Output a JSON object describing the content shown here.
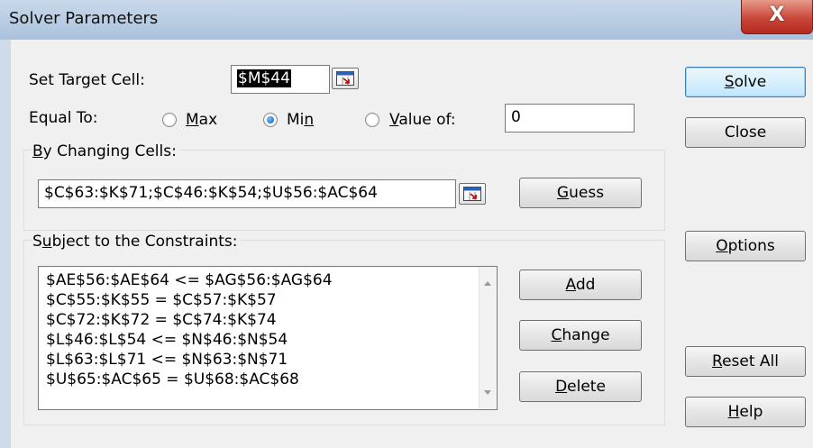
{
  "window": {
    "title": "Solver Parameters",
    "close_glyph": "X"
  },
  "target": {
    "label": "Set Target Cell:",
    "value": "$M$44"
  },
  "equal_to": {
    "label": "Equal To:",
    "options": [
      {
        "label": "Max",
        "selected": false
      },
      {
        "label": "Min",
        "selected": true
      },
      {
        "label": "Value of:",
        "selected": false
      }
    ],
    "value_of": "0"
  },
  "changing": {
    "label": "By Changing Cells:",
    "value": "$C$63:$K$71;$C$46:$K$54;$U$56:$AC$64",
    "guess_label": "Guess"
  },
  "constraints": {
    "label": "Subject to the Constraints:",
    "items": [
      "$AE$56:$AE$64 <= $AG$56:$AG$64",
      "$C$55:$K$55 = $C$57:$K$57",
      "$C$72:$K$72 = $C$74:$K$74",
      "$L$46:$L$54 <= $N$46:$N$54",
      "$L$63:$L$71 <= $N$63:$N$71",
      "$U$65:$AC$65 = $U$68:$AC$68"
    ],
    "add_label": "Add",
    "change_label": "Change",
    "delete_label": "Delete"
  },
  "side_buttons": {
    "solve": "Solve",
    "close": "Close",
    "options": "Options",
    "reset_all": "Reset All",
    "help": "Help"
  },
  "icons": {
    "ref_button": "collapse-dialog-icon",
    "close": "close-icon"
  }
}
